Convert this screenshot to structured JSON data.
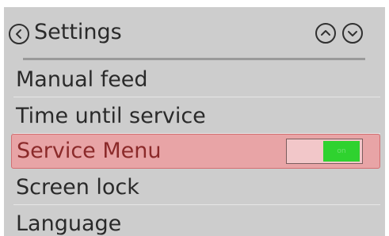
{
  "header": {
    "title": "Settings",
    "back_icon": "chevron-left-icon",
    "up_icon": "chevron-up-icon",
    "down_icon": "chevron-down-icon"
  },
  "menu": {
    "items": [
      {
        "label": "Manual feed",
        "selected": false
      },
      {
        "label": "Time until service",
        "selected": false
      },
      {
        "label": "Service Menu",
        "selected": true,
        "toggle": {
          "state": "on",
          "label": "on"
        }
      },
      {
        "label": "Screen lock",
        "selected": false
      },
      {
        "label": "Language",
        "selected": false
      }
    ]
  },
  "colors": {
    "background": "#cdcdcd",
    "text": "#2a2a2a",
    "selected_background": "#e8a4a6",
    "selected_text": "#8b2a2a",
    "toggle_on": "#2fd22f"
  }
}
